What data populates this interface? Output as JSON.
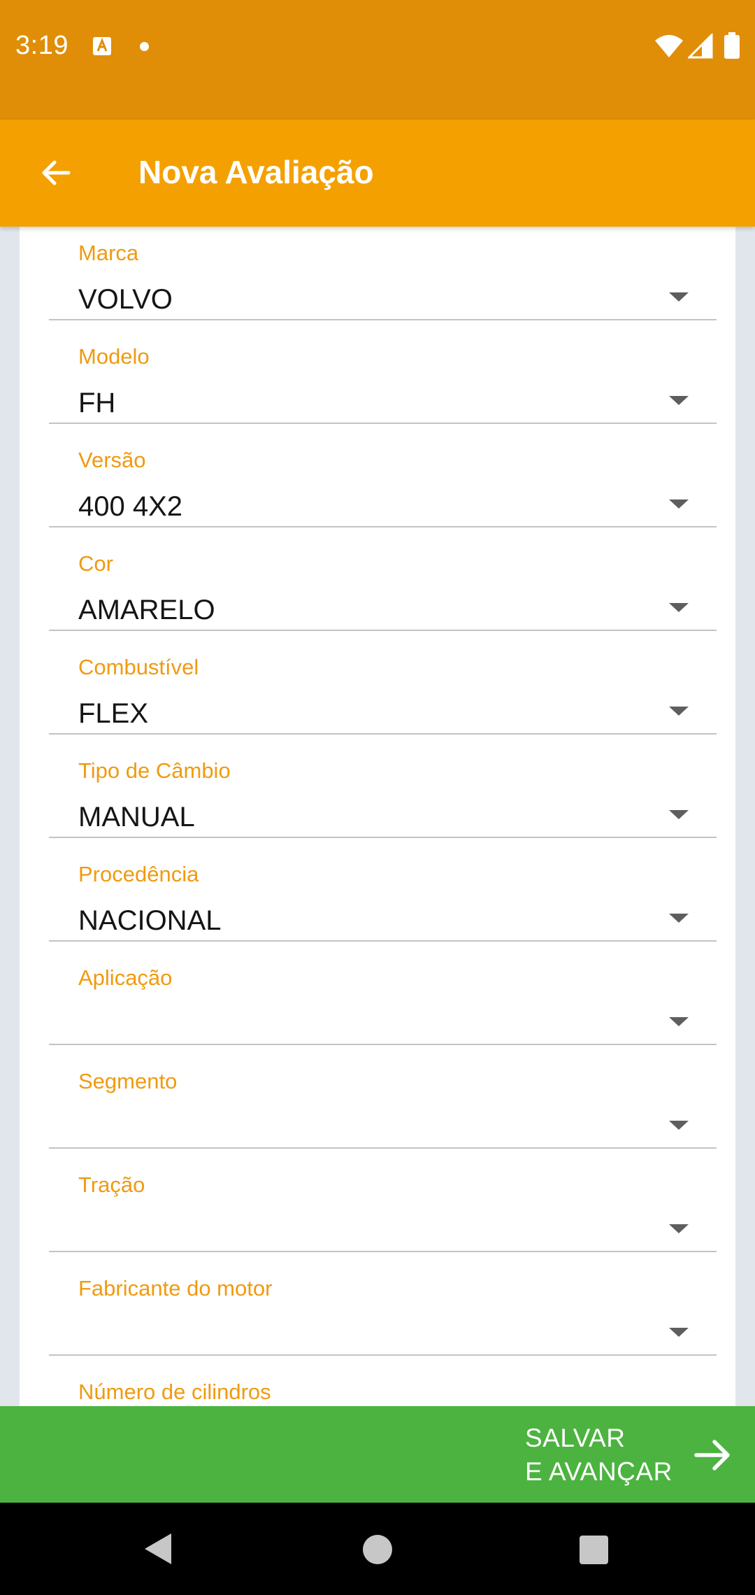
{
  "status_bar": {
    "time": "3:19",
    "icons": [
      "font-notification-icon",
      "notification-dot-icon",
      "wifi-icon",
      "signal-icon",
      "battery-icon"
    ]
  },
  "app_bar": {
    "title": "Nova Avaliação",
    "back_icon": "arrow-back-icon"
  },
  "form": {
    "fields": [
      {
        "label": "Marca",
        "value": "VOLVO"
      },
      {
        "label": "Modelo",
        "value": "FH"
      },
      {
        "label": "Versão",
        "value": "400 4X2"
      },
      {
        "label": "Cor",
        "value": "AMARELO"
      },
      {
        "label": "Combustível",
        "value": "FLEX"
      },
      {
        "label": "Tipo de Câmbio",
        "value": "MANUAL"
      },
      {
        "label": "Procedência",
        "value": "NACIONAL"
      },
      {
        "label": "Aplicação",
        "value": ""
      },
      {
        "label": "Segmento",
        "value": ""
      },
      {
        "label": "Tração",
        "value": ""
      },
      {
        "label": "Fabricante do motor",
        "value": ""
      },
      {
        "label": "Número de cilindros",
        "value": ""
      }
    ]
  },
  "save_bar": {
    "label_line1": "SALVAR",
    "label_line2": "E AVANÇAR",
    "icon": "arrow-forward-icon"
  },
  "colors": {
    "status_bar": "#e08e08",
    "app_bar": "#f4a000",
    "label": "#f09a10",
    "save_bar": "#4cb340",
    "background": "#e1e6ec"
  }
}
